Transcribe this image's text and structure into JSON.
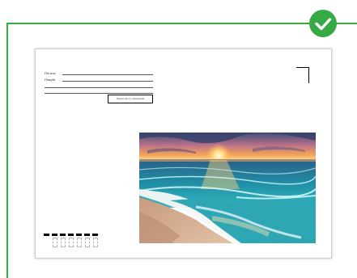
{
  "envelope": {
    "from_label": "От кого",
    "address_label": "Откуда",
    "index_box_text": "Индекс места отправления"
  },
  "colors": {
    "frame_green": "#3aab3a",
    "badge_green": "#34a945"
  },
  "icons": {
    "badge": "checkmark-icon"
  }
}
